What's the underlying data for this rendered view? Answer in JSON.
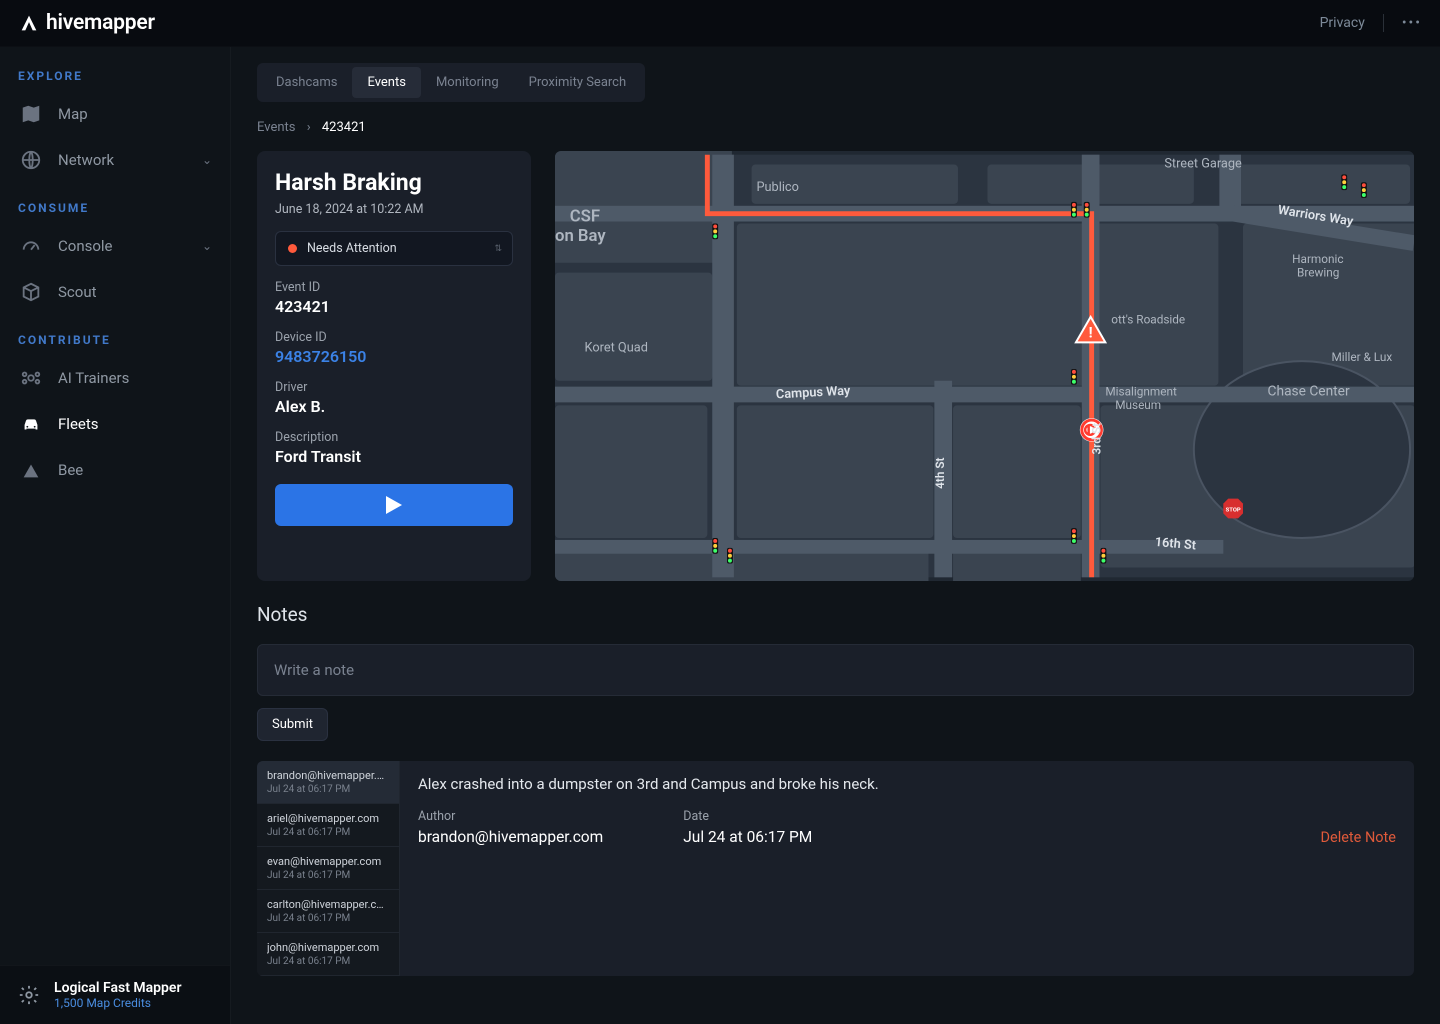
{
  "brand": "hivemapper",
  "topbar": {
    "privacy": "Privacy"
  },
  "sidebar": {
    "sections": [
      {
        "title": "EXPLORE",
        "items": [
          {
            "label": "Map"
          },
          {
            "label": "Network",
            "chevron": true
          }
        ]
      },
      {
        "title": "CONSUME",
        "items": [
          {
            "label": "Console",
            "chevron": true
          },
          {
            "label": "Scout"
          }
        ]
      },
      {
        "title": "CONTRIBUTE",
        "items": [
          {
            "label": "AI Trainers"
          },
          {
            "label": "Fleets",
            "active": true
          },
          {
            "label": "Bee"
          }
        ]
      }
    ],
    "footer": {
      "name": "Logical Fast Mapper",
      "credits": "1,500 Map Credits"
    }
  },
  "tabs": [
    {
      "label": "Dashcams"
    },
    {
      "label": "Events",
      "active": true
    },
    {
      "label": "Monitoring"
    },
    {
      "label": "Proximity Search"
    }
  ],
  "breadcrumb": {
    "root": "Events",
    "current": "423421"
  },
  "event": {
    "title": "Harsh Braking",
    "datetime": "June 18, 2024 at 10:22 AM",
    "status": "Needs Attention",
    "fields": {
      "eventIdLabel": "Event ID",
      "eventId": "423421",
      "deviceIdLabel": "Device ID",
      "deviceId": "9483726150",
      "driverLabel": "Driver",
      "driver": "Alex B.",
      "descLabel": "Description",
      "desc": "Ford Transit"
    }
  },
  "map": {
    "labels": {
      "csf": "CSF",
      "onBay": "on Bay",
      "publico": "Publico",
      "streetGarage": "Street Garage",
      "warriorsWay": "Warriors Way",
      "harmonic": "Harmonic",
      "brewing": "Brewing",
      "koret": "Koret Quad",
      "campusWay": "Campus Way",
      "thirdSt": "3rd St",
      "fourthSt": "4th St",
      "sixteenth": "16th St",
      "otts": "ott's Roadside",
      "misalignment": "Misalignment",
      "museum": "Museum",
      "chase": "Chase Center",
      "miller": "Miller & Lux",
      "stop": "STOP"
    }
  },
  "notes": {
    "title": "Notes",
    "placeholder": "Write a note",
    "submit": "Submit",
    "list": [
      {
        "email": "brandon@hivemapper.c...",
        "ts": "Jul 24 at 06:17 PM",
        "selected": true
      },
      {
        "email": "ariel@hivemapper.com",
        "ts": "Jul 24 at 06:17 PM"
      },
      {
        "email": "evan@hivemapper.com",
        "ts": "Jul 24 at 06:17 PM"
      },
      {
        "email": "carlton@hivemapper.co...",
        "ts": "Jul 24 at 06:17 PM"
      },
      {
        "email": "john@hivemapper.com",
        "ts": "Jul 24 at 06:17 PM"
      }
    ],
    "selected": {
      "text": "Alex crashed into a dumpster on 3rd and Campus and broke his neck.",
      "authorLabel": "Author",
      "author": "brandon@hivemapper.com",
      "dateLabel": "Date",
      "date": "Jul 24 at 06:17 PM",
      "delete": "Delete Note"
    }
  }
}
